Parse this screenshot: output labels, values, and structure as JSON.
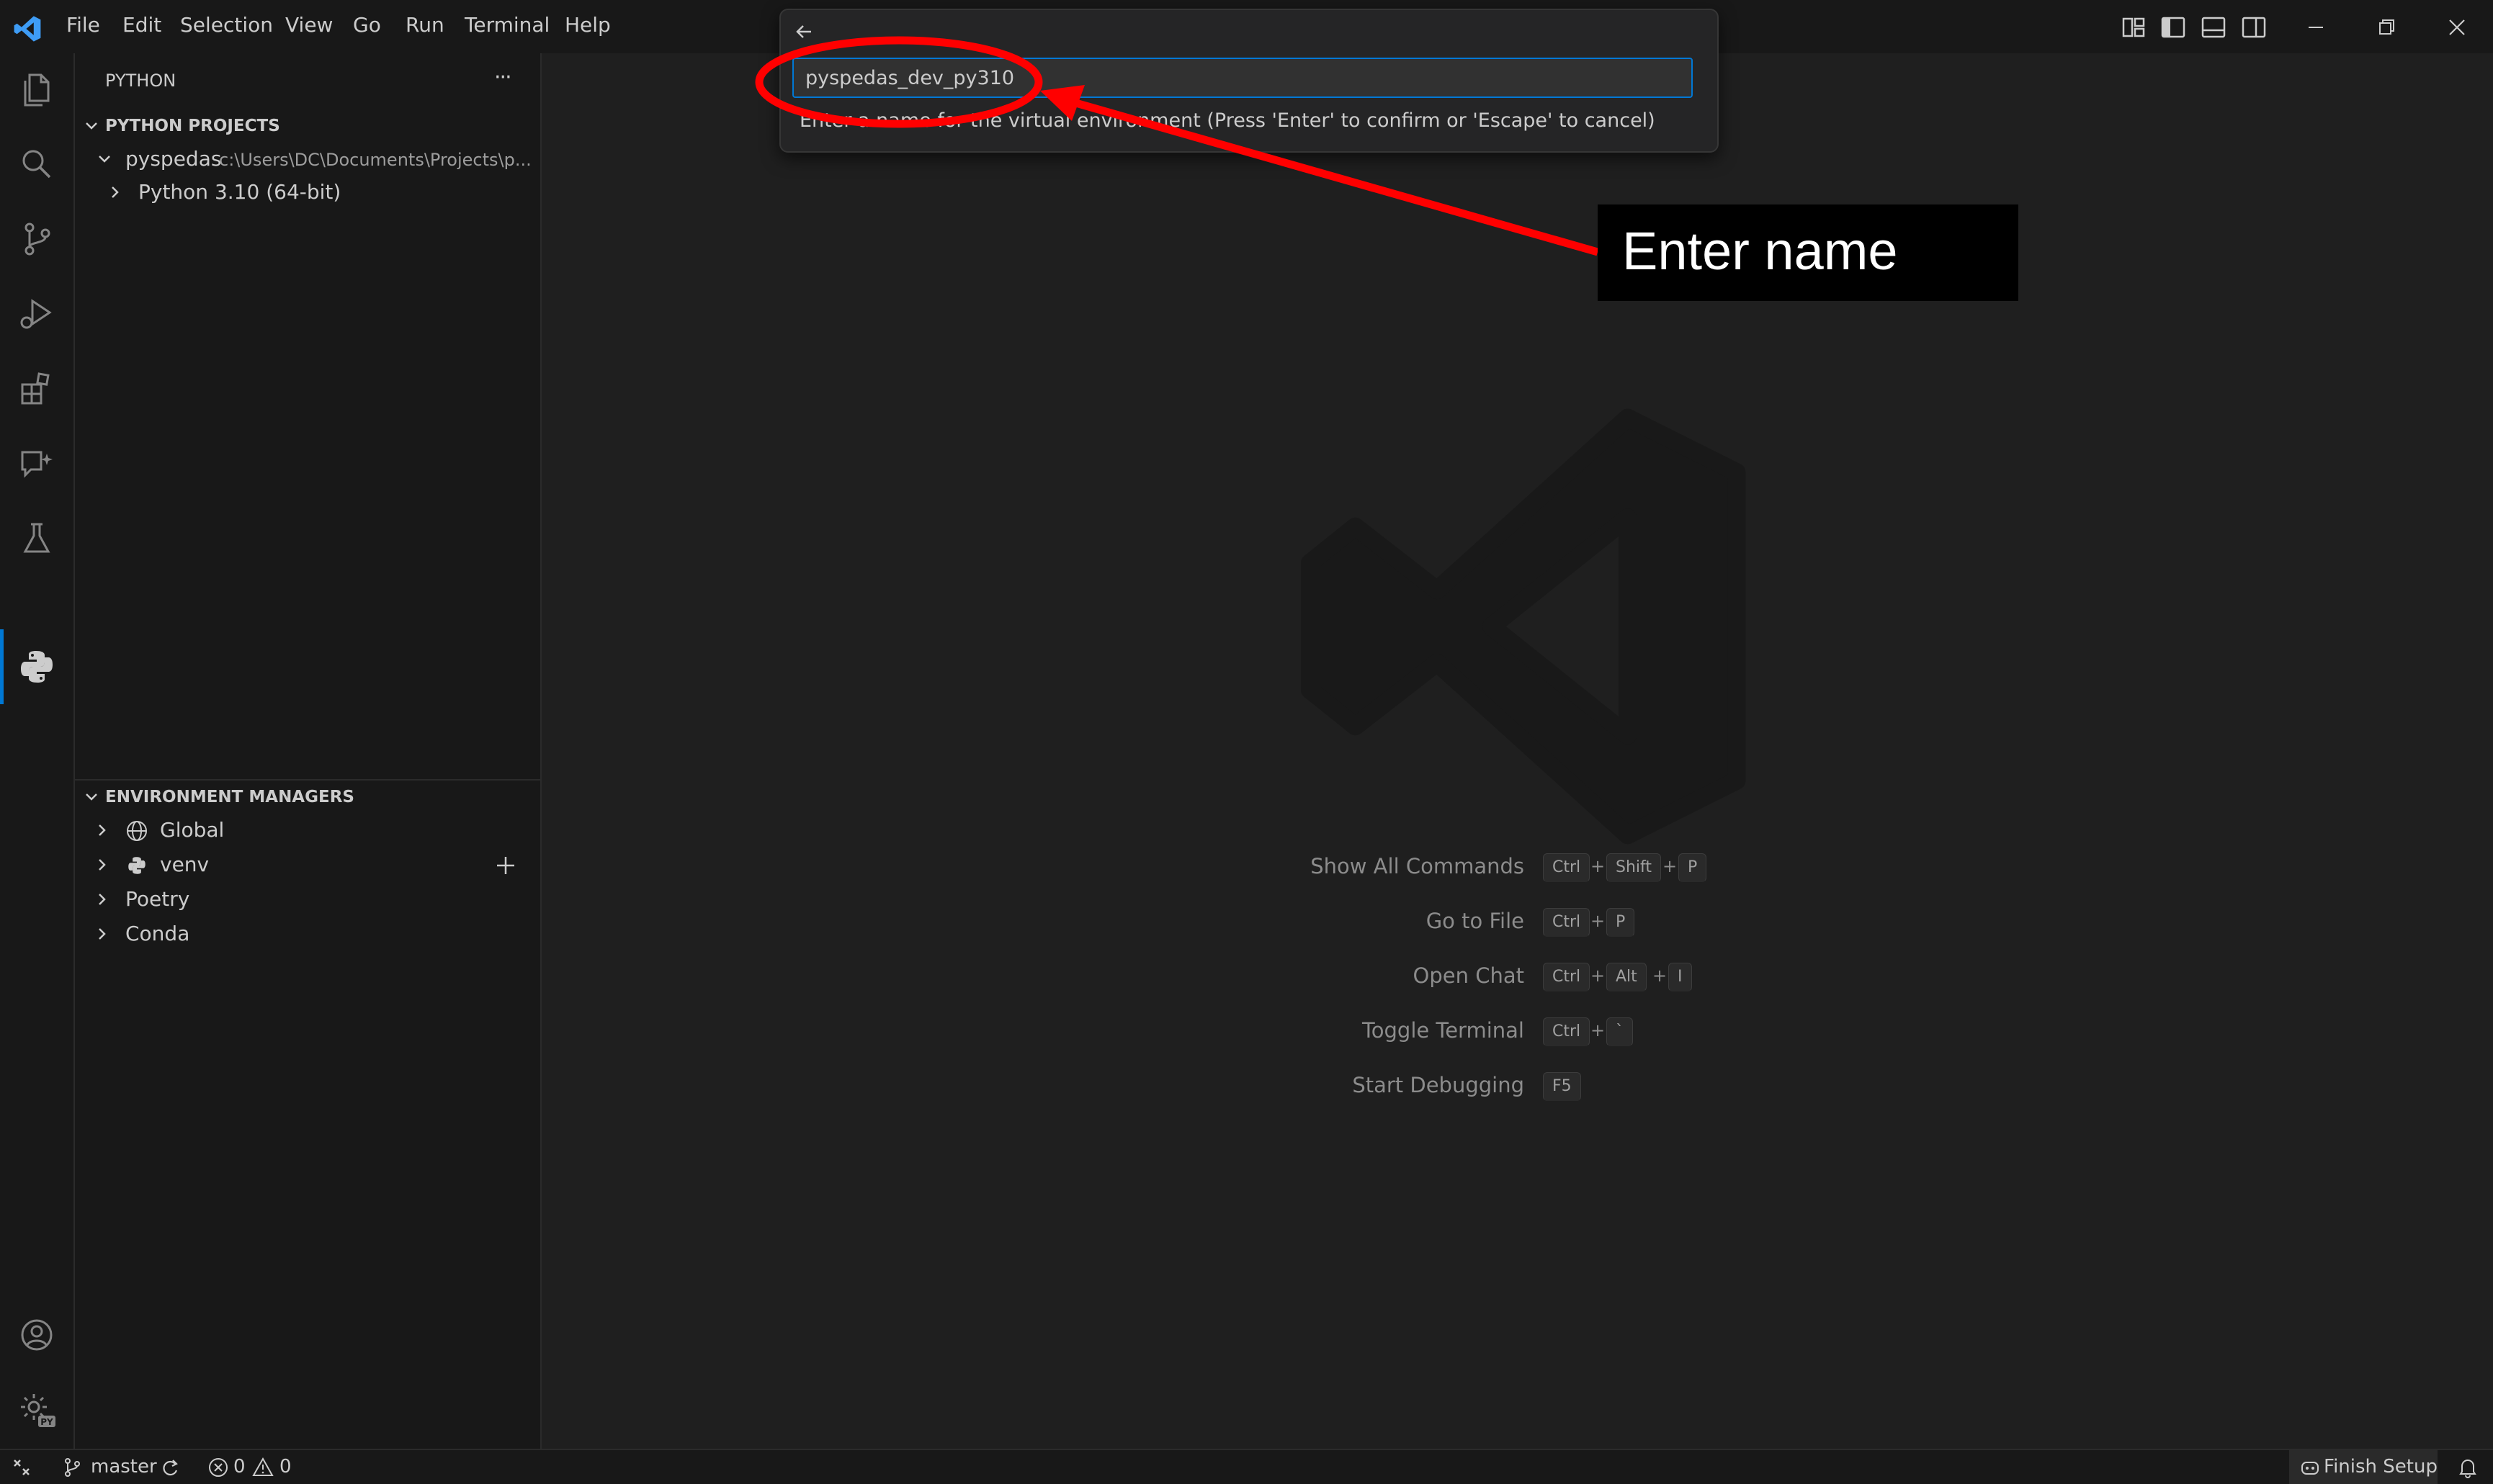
{
  "menu": [
    "File",
    "Edit",
    "Selection",
    "View",
    "Go",
    "Run",
    "Terminal",
    "Help"
  ],
  "sidebar": {
    "title": "PYTHON",
    "more_label": "···",
    "projects_header": "PYTHON PROJECTS",
    "project": {
      "name": "pyspedas",
      "path": "c:\\Users\\DC\\Documents\\Projects\\p...",
      "interpreter": "Python 3.10 (64-bit)"
    },
    "env_header": "ENVIRONMENT MANAGERS",
    "env_managers": [
      "Global",
      "venv",
      "Poetry",
      "Conda"
    ]
  },
  "quick_input": {
    "value": "pyspedas_dev_py310",
    "message": "Enter a name for the virtual environment (Press 'Enter' to confirm or 'Escape' to cancel)"
  },
  "annotation": {
    "text": "Enter name",
    "color": "#ff0000"
  },
  "shortcuts": [
    {
      "label": "Show All Commands",
      "keys": [
        "Ctrl",
        "Shift",
        "P"
      ]
    },
    {
      "label": "Go to File",
      "keys": [
        "Ctrl",
        "P"
      ]
    },
    {
      "label": "Open Chat",
      "keys": [
        "Ctrl",
        "Alt",
        "I"
      ]
    },
    {
      "label": "Toggle Terminal",
      "keys": [
        "Ctrl",
        "`"
      ]
    },
    {
      "label": "Start Debugging",
      "keys": [
        "F5"
      ]
    }
  ],
  "statusbar": {
    "branch": "master",
    "errors": "0",
    "warnings": "0",
    "finish_setup": "Finish Setup"
  },
  "colors": {
    "accent": "#0078d4",
    "vscode_logo": "#3e9cf5",
    "annotation_red": "#ff0000"
  }
}
